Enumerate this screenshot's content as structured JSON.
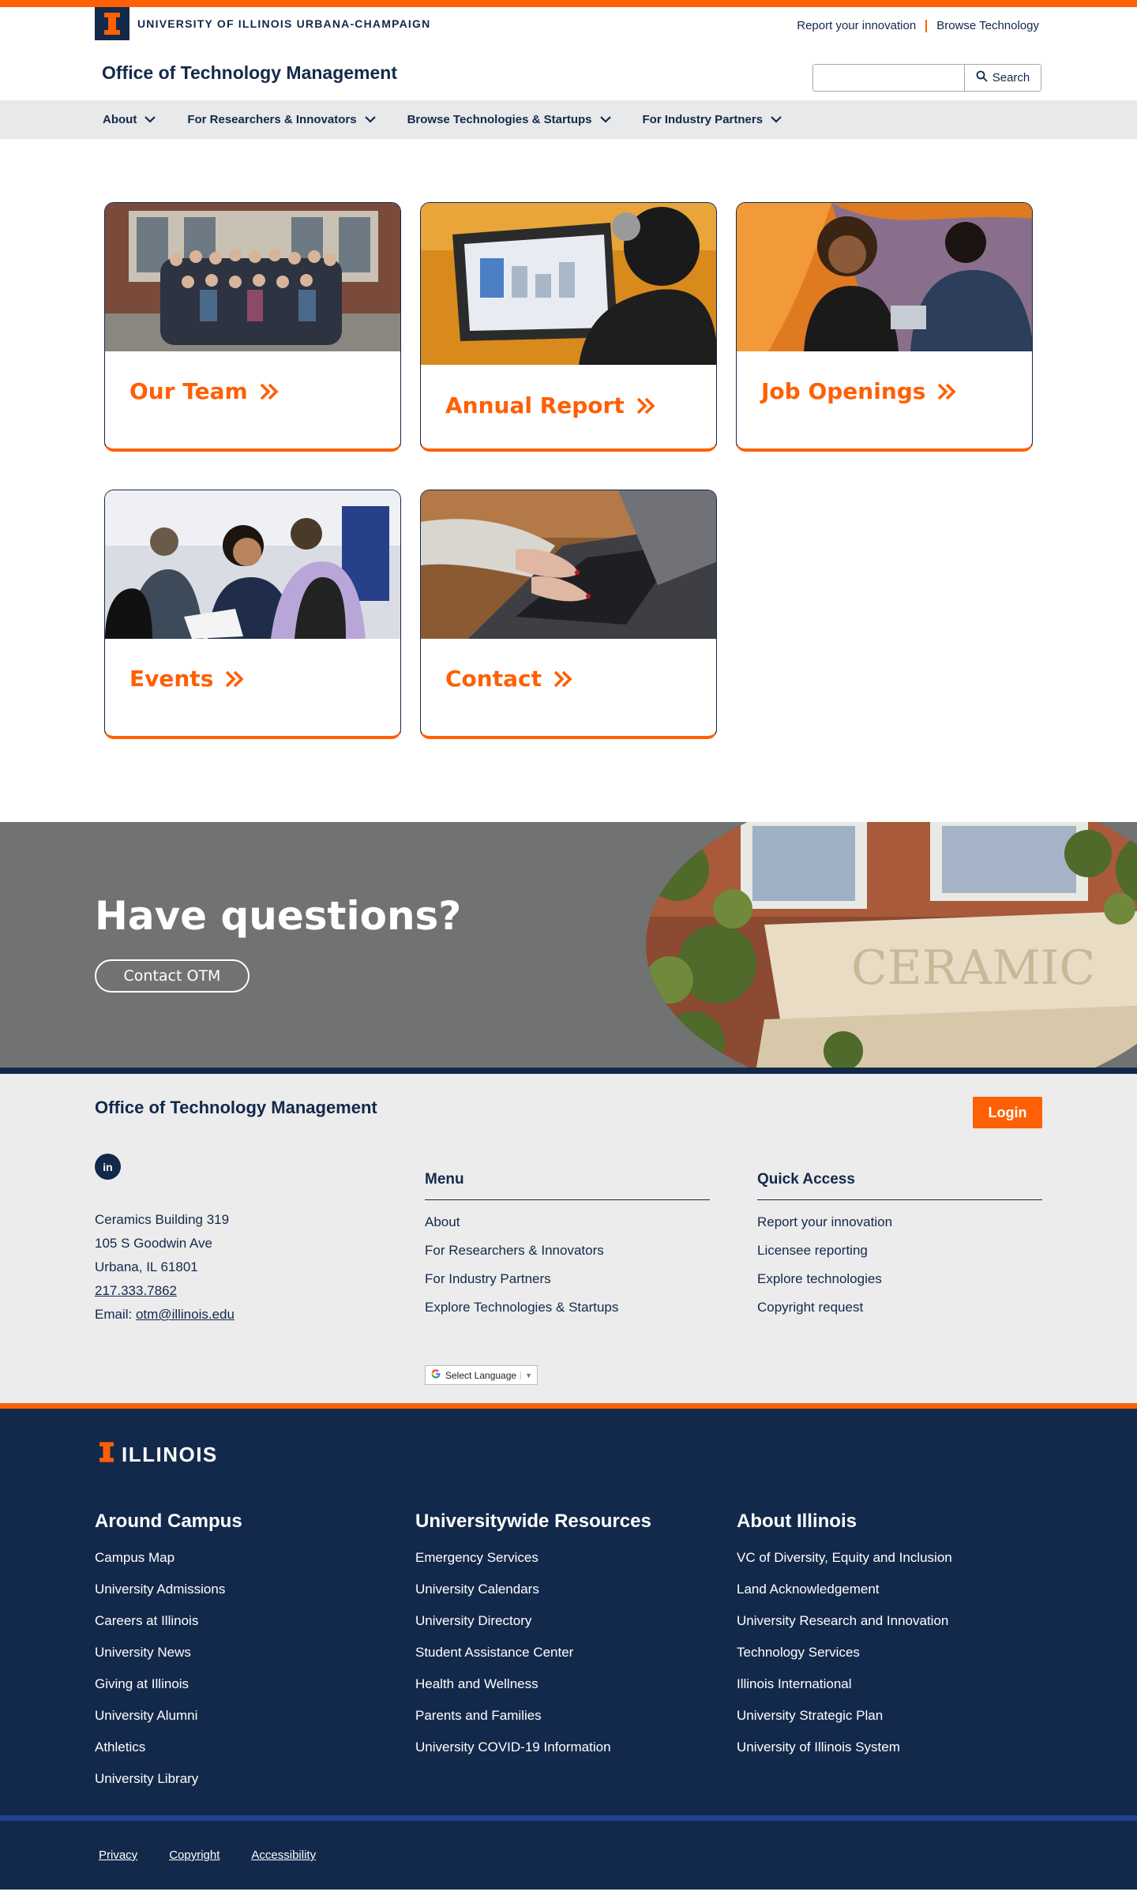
{
  "header": {
    "university_name": "UNIVERSITY OF ILLINOIS URBANA-CHAMPAIGN",
    "utility_links": [
      "Report your innovation",
      "Browse Technology"
    ],
    "site_title": "Office of Technology Management",
    "search": {
      "placeholder": "",
      "button_label": "Search"
    }
  },
  "nav": {
    "items": [
      {
        "label": "About"
      },
      {
        "label": "For Researchers & Innovators"
      },
      {
        "label": "Browse Technologies & Startups"
      },
      {
        "label": "For Industry Partners"
      }
    ]
  },
  "cards": [
    {
      "label": "Our Team",
      "image": "team-group-photo"
    },
    {
      "label": "Annual Report",
      "image": "laptop-report-photo"
    },
    {
      "label": "Job Openings",
      "image": "students-talking-photo"
    },
    {
      "label": "Events",
      "image": "event-networking-photo"
    },
    {
      "label": "Contact",
      "image": "typing-laptop-photo"
    }
  ],
  "questions": {
    "heading": "Have questions?",
    "button_label": "Contact OTM",
    "image": "ceramics-building-facade-photo"
  },
  "otm_footer": {
    "title": "Office of Technology Management",
    "login_label": "Login",
    "social_icon": "linkedin-icon",
    "address": {
      "line1": "Ceramics Building 319",
      "line2": "105 S Goodwin Ave",
      "line3": "Urbana, IL 61801",
      "phone": "217.333.7862",
      "email_label": "Email: ",
      "email": "otm@illinois.edu"
    },
    "menu": {
      "heading": "Menu",
      "items": [
        "About",
        "For Researchers & Innovators",
        "For Industry Partners",
        "Explore Technologies & Startups"
      ]
    },
    "quick_access": {
      "heading": "Quick Access",
      "items": [
        "Report your innovation",
        "Licensee reporting",
        "Explore technologies",
        "Copyright request"
      ]
    },
    "language_select": "Select Language"
  },
  "illinois_footer": {
    "logo_text": "ILLINOIS",
    "columns": [
      {
        "heading": "Around Campus",
        "items": [
          "Campus Map",
          "University Admissions",
          "Careers at Illinois",
          "University News",
          "Giving at Illinois",
          "University Alumni",
          "Athletics",
          "University Library"
        ]
      },
      {
        "heading": "Universitywide Resources",
        "items": [
          "Emergency Services",
          "University Calendars",
          "University Directory",
          "Student Assistance Center",
          "Health and Wellness",
          "Parents and Families",
          "University COVID-19 Information"
        ]
      },
      {
        "heading": "About Illinois",
        "items": [
          "VC of Diversity, Equity and Inclusion",
          "Land Acknowledgement",
          "University Research and Innovation",
          "Technology Services",
          "Illinois International",
          "University Strategic Plan",
          "University of Illinois System"
        ]
      }
    ],
    "legal_links": [
      "Privacy",
      "Copyright",
      "Accessibility"
    ]
  },
  "colors": {
    "orange": "#ff5f05",
    "navy": "#13294b",
    "gray_band": "#707372",
    "light_bg": "#ececec"
  }
}
